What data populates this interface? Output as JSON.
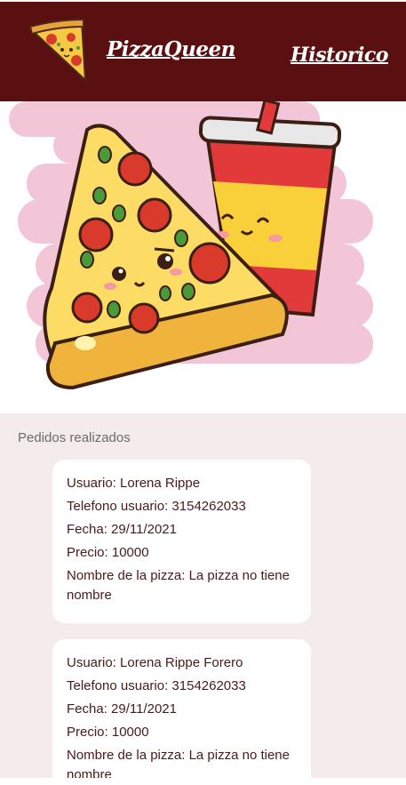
{
  "header": {
    "brand": "PizzaQueen",
    "nav_historico": "Historico"
  },
  "icons": {
    "logo": "pizza-slice-icon",
    "hero": "pizza-and-soda-illustration"
  },
  "colors": {
    "header_bg": "#5a1010",
    "page_bg": "#f4ecec",
    "card_bg": "#ffffff"
  },
  "orders_section": {
    "title": "Pedidos realizados",
    "orders": [
      {
        "usuario": "Usuario: Lorena Rippe",
        "telefono": "Telefono usuario: 3154262033",
        "fecha": "Fecha: 29/11/2021",
        "precio": "Precio: 10000",
        "pizza": "Nombre de la pizza: La pizza no tiene nombre"
      },
      {
        "usuario": "Usuario: Lorena Rippe Forero",
        "telefono": "Telefono usuario: 3154262033",
        "fecha": "Fecha: 29/11/2021",
        "precio": "Precio: 10000",
        "pizza": "Nombre de la pizza: La pizza no tiene nombre"
      }
    ]
  }
}
